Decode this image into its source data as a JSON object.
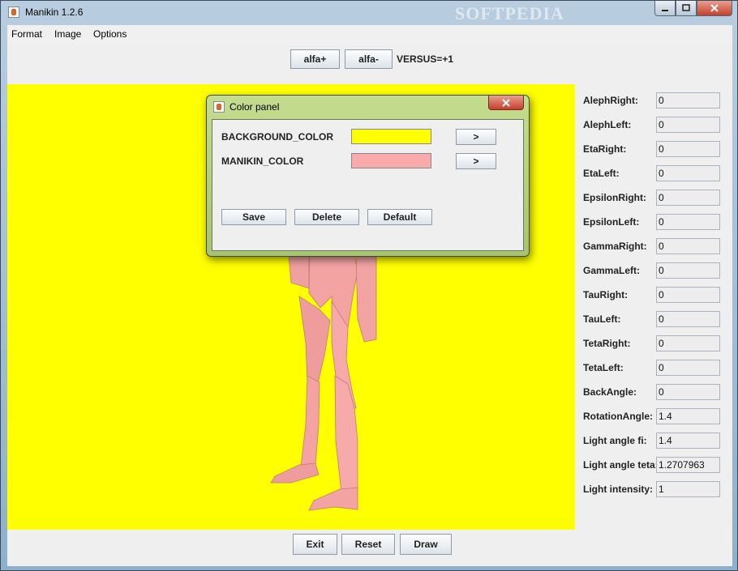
{
  "window": {
    "title": "Manikin 1.2.6",
    "watermark": "SOFTPEDIA",
    "icons": {
      "app": "java-cup-icon",
      "minimize": "minimize-icon",
      "maximize": "maximize-icon",
      "close": "close-icon"
    }
  },
  "menu": [
    "Format",
    "Image",
    "Options"
  ],
  "toolbar": {
    "alfa_plus": "alfa+",
    "alfa_minus": "alfa-",
    "versus": "VERSUS=+1"
  },
  "canvas": {
    "background_color": "#ffff00",
    "manikin_color": "#f4a3a3"
  },
  "params": [
    {
      "label": "AlephRight:",
      "value": "0"
    },
    {
      "label": "AlephLeft:",
      "value": "0"
    },
    {
      "label": "EtaRight:",
      "value": "0"
    },
    {
      "label": "EtaLeft:",
      "value": "0"
    },
    {
      "label": "EpsilonRight:",
      "value": "0"
    },
    {
      "label": "EpsilonLeft:",
      "value": "0"
    },
    {
      "label": "GammaRight:",
      "value": "0"
    },
    {
      "label": "GammaLeft:",
      "value": "0"
    },
    {
      "label": "TauRight:",
      "value": "0"
    },
    {
      "label": "TauLeft:",
      "value": "0"
    },
    {
      "label": "TetaRight:",
      "value": "0"
    },
    {
      "label": "TetaLeft:",
      "value": "0"
    },
    {
      "label": "BackAngle:",
      "value": "0"
    },
    {
      "label": "RotationAngle:",
      "value": "1.4"
    },
    {
      "label": "Light angle fi:",
      "value": "1.4"
    },
    {
      "label": "Light angle teta:",
      "value": "1.2707963"
    },
    {
      "label": "Light intensity:",
      "value": "1"
    }
  ],
  "bottom": {
    "exit": "Exit",
    "reset": "Reset",
    "draw": "Draw"
  },
  "dialog": {
    "title": "Color panel",
    "rows": [
      {
        "label": "BACKGROUND_COLOR",
        "color": "#ffff00",
        "button": ">"
      },
      {
        "label": "MANIKIN_COLOR",
        "color": "#f9aaaa",
        "button": ">"
      }
    ],
    "save": "Save",
    "delete": "Delete",
    "default": "Default"
  }
}
